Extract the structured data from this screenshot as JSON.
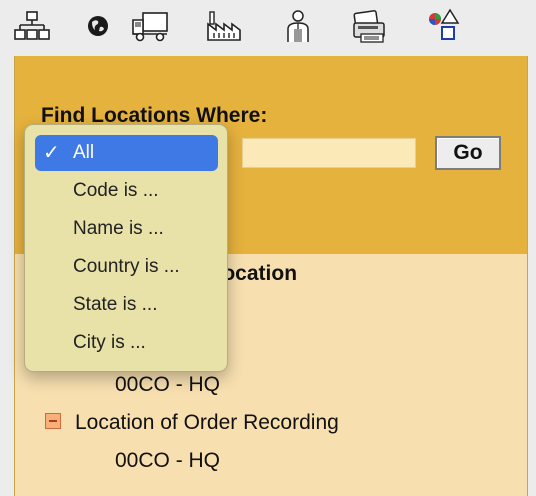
{
  "toolbar": {
    "icons": [
      "hierarchy-icon",
      "globe-icon",
      "truck-icon",
      "factory-icon",
      "person-icon",
      "printer-icon",
      "shapes-icon"
    ]
  },
  "search": {
    "heading": "Find Locations Where:",
    "input_value": "",
    "go_label": "Go"
  },
  "dropdown": {
    "selected": "All",
    "options": [
      "All",
      "Code is ...",
      "Name is ...",
      "Country is ...",
      "State is ...",
      "City is ..."
    ]
  },
  "content": {
    "section_heading": "c location",
    "item1_value": "00CO - HQ",
    "item2_label": "Location of Order Recording",
    "item2_value": "00CO - HQ"
  },
  "colors": {
    "panel_header": "#e6b23e",
    "panel_body": "#f7dfaf",
    "selected": "#3f79e6"
  }
}
